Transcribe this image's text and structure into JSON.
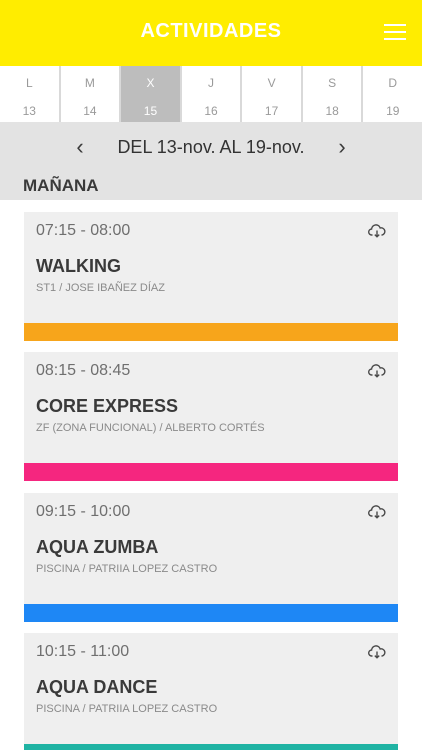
{
  "header": {
    "title": "ACTIVIDADES",
    "menu_icon": "hamburger-menu-icon"
  },
  "days": [
    {
      "letter": "L",
      "number": "13",
      "active": false
    },
    {
      "letter": "M",
      "number": "14",
      "active": false
    },
    {
      "letter": "X",
      "number": "15",
      "active": true
    },
    {
      "letter": "J",
      "number": "16",
      "active": false
    },
    {
      "letter": "V",
      "number": "17",
      "active": false
    },
    {
      "letter": "S",
      "number": "18",
      "active": false
    },
    {
      "letter": "D",
      "number": "19",
      "active": false
    }
  ],
  "week_nav": {
    "prev": "‹",
    "range": "DEL 13-nov. AL 19-nov.",
    "next": "›"
  },
  "section": {
    "title": "MAÑANA"
  },
  "activities": [
    {
      "time": "07:15 - 08:00",
      "name": "WALKING",
      "detail": "ST1 / JOSE IBAÑEZ DÍAZ",
      "color": "#f7a51b",
      "icon": "cloud-download-icon"
    },
    {
      "time": "08:15 - 08:45",
      "name": "CORE EXPRESS",
      "detail": "ZF (ZONA FUNCIONAL) / ALBERTO CORTÉS",
      "color": "#f5267f",
      "icon": "cloud-download-icon"
    },
    {
      "time": "09:15 - 10:00",
      "name": "AQUA ZUMBA",
      "detail": "PISCINA / PATRIIA LOPEZ CASTRO",
      "color": "#1e87f5",
      "icon": "cloud-download-icon"
    },
    {
      "time": "10:15 - 11:00",
      "name": "AQUA DANCE",
      "detail": "PISCINA / PATRIIA LOPEZ CASTRO",
      "color": "#1fb3a3",
      "icon": "cloud-download-icon"
    }
  ]
}
